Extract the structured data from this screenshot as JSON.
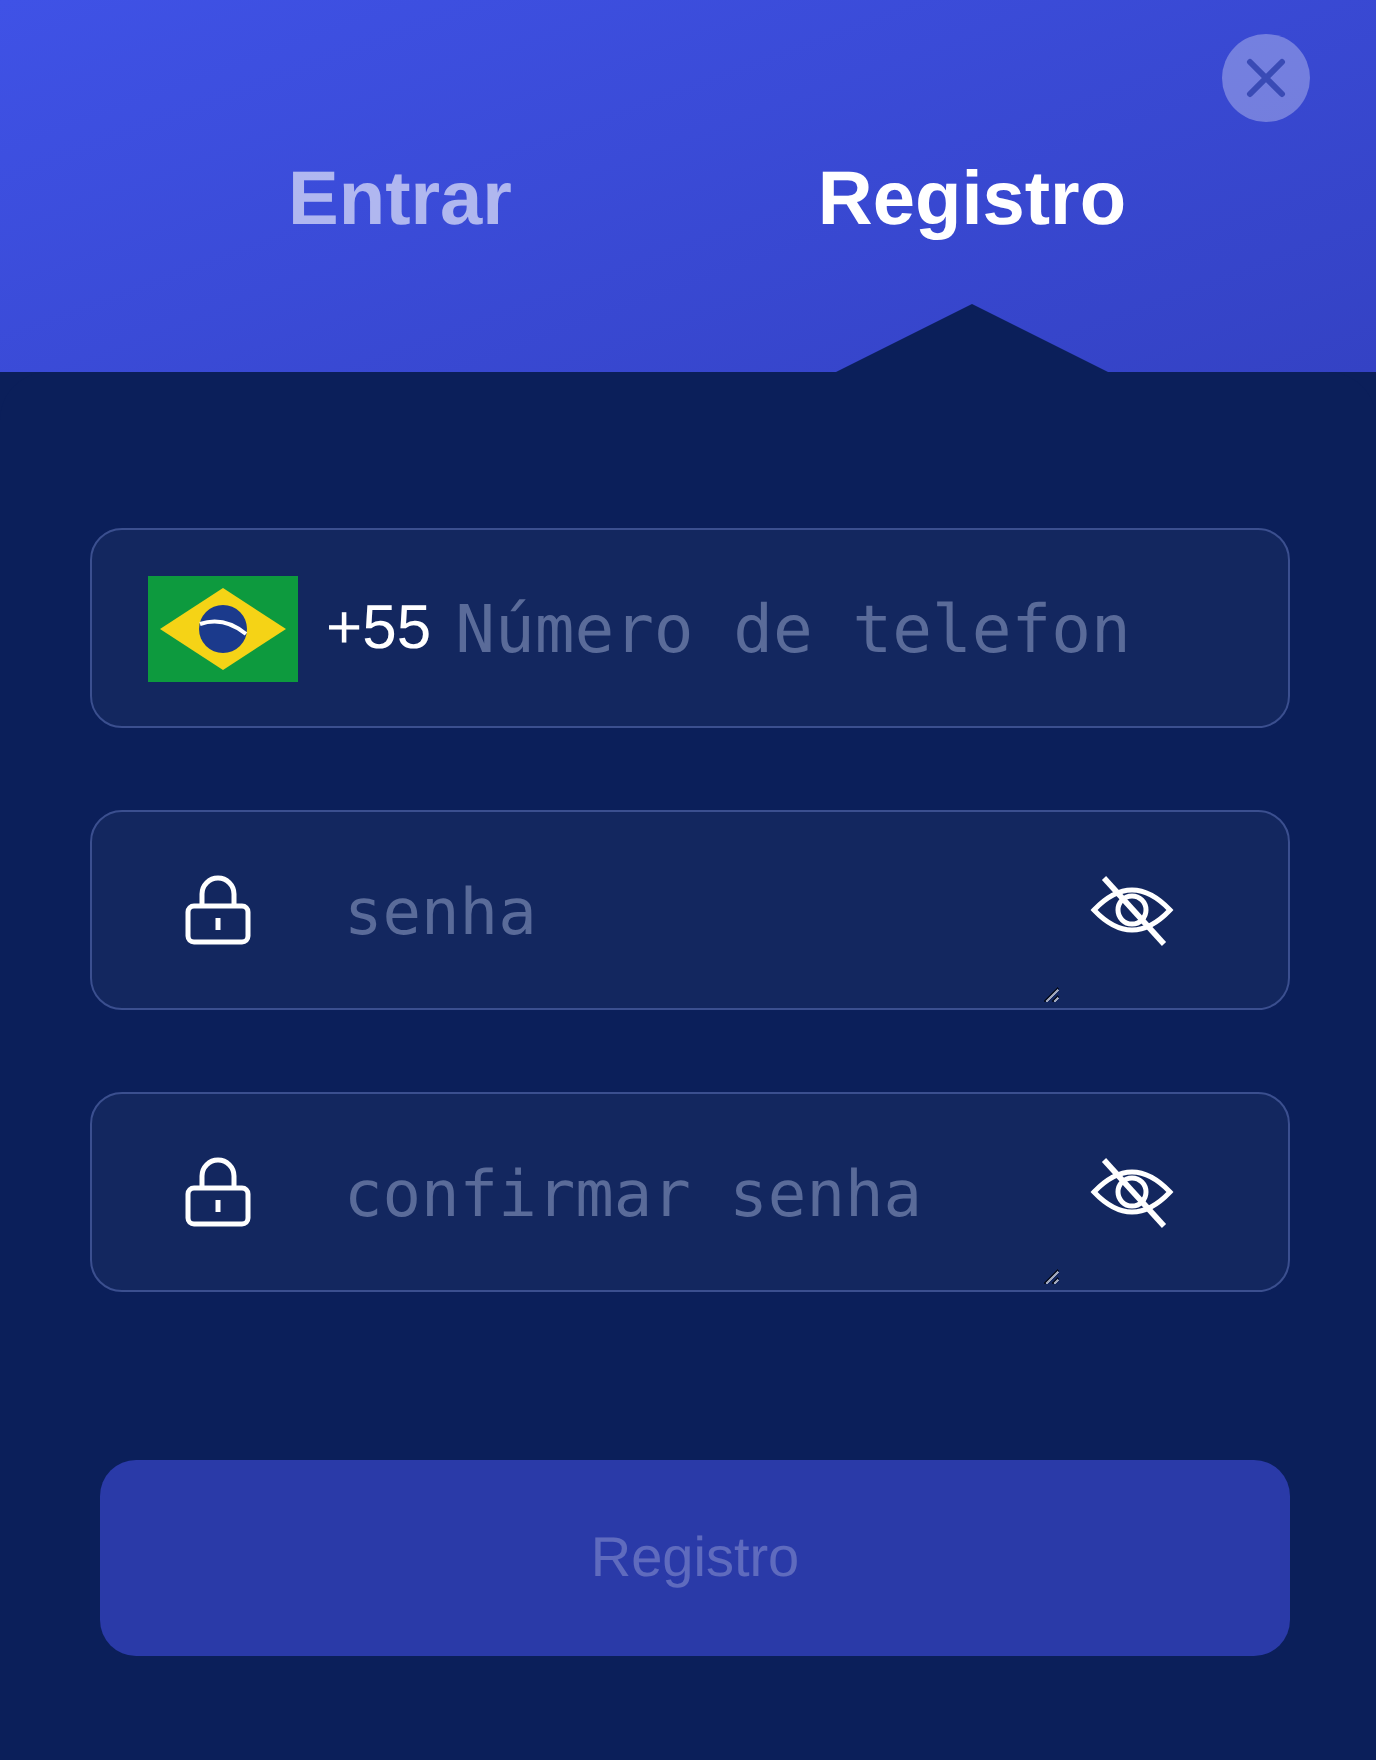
{
  "tabs": [
    {
      "label": "Entrar",
      "selected": false
    },
    {
      "label": "Registro",
      "selected": true
    }
  ],
  "phone": {
    "country_code": "+55",
    "placeholder": "Número de telefon"
  },
  "password_fields": [
    {
      "placeholder": "senha",
      "visible": false
    },
    {
      "placeholder": "confirmar senha",
      "visible": false
    }
  ],
  "submit": {
    "label": "Registro",
    "disabled": true
  }
}
